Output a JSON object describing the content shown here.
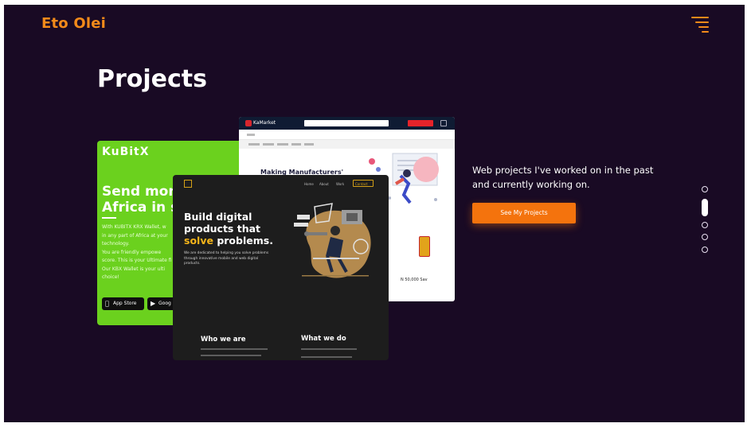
{
  "header": {
    "logo": "Eto Olei",
    "menu_icon": "hamburger-menu-icon"
  },
  "page_title": "Projects",
  "slides": {
    "kubitx": {
      "logo": "KuBitX",
      "headline_line1": "Send mon",
      "headline_line2": "Africa in s",
      "body_lines": [
        "With KUBITX KRX Wallet, w",
        "in any part of Africa at your",
        "technology.",
        "You are friendly empowe",
        "score. This is your Ultimate fi",
        "Our KBX Wallet is your ulti",
        "choice!"
      ],
      "app_store": "App Store",
      "play_store": "Goog"
    },
    "shop": {
      "brand": "KaMarket",
      "hero_text": "Making Manufacturers'",
      "price": "N 50,000 Sav"
    },
    "dark": {
      "headline_line1": "Build digital",
      "headline_line2": "products that",
      "headline_highlight": "solve",
      "headline_rest": "problems.",
      "sub_line1": "We are dedicated to helping you solve problems",
      "sub_line2": "through innovative mobile and web digital",
      "sub_line3": "products.",
      "section_who": "Who we are",
      "section_what": "What we do",
      "nav": [
        "Home",
        "About",
        "Work",
        "Contact"
      ]
    }
  },
  "description": "Web projects I've worked on in the past and currently working on.",
  "cta_label": "See My Projects",
  "carousel": {
    "count": 5,
    "active_index": 1
  },
  "colors": {
    "background": "#190a24",
    "accent": "#f28a1a",
    "button": "#f4730d",
    "kubitx_green": "#6bd11e",
    "highlight_yellow": "#f4b41a"
  }
}
